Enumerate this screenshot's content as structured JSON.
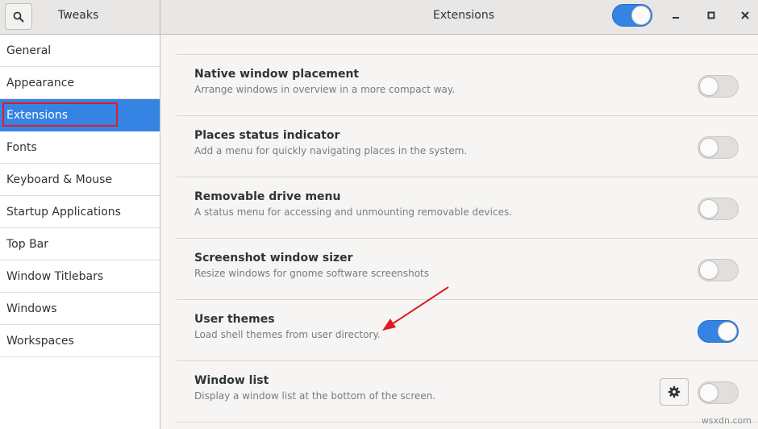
{
  "app": {
    "title": "Tweaks",
    "page_title": "Extensions",
    "extensions_global_enabled": true
  },
  "sidebar": {
    "items": [
      {
        "label": "General"
      },
      {
        "label": "Appearance"
      },
      {
        "label": "Extensions",
        "selected": true
      },
      {
        "label": "Fonts"
      },
      {
        "label": "Keyboard & Mouse"
      },
      {
        "label": "Startup Applications"
      },
      {
        "label": "Top Bar"
      },
      {
        "label": "Window Titlebars"
      },
      {
        "label": "Windows"
      },
      {
        "label": "Workspaces"
      }
    ]
  },
  "extensions": [
    {
      "name": "Native window placement",
      "description": "Arrange windows in overview in a more compact way.",
      "enabled": false,
      "has_settings": false
    },
    {
      "name": "Places status indicator",
      "description": "Add a menu for quickly navigating places in the system.",
      "enabled": false,
      "has_settings": false
    },
    {
      "name": "Removable drive menu",
      "description": "A status menu for accessing and unmounting removable devices.",
      "enabled": false,
      "has_settings": false
    },
    {
      "name": "Screenshot window sizer",
      "description": "Resize windows for gnome software screenshots",
      "enabled": false,
      "has_settings": false
    },
    {
      "name": "User themes",
      "description": "Load shell themes from user directory.",
      "enabled": true,
      "has_settings": false
    },
    {
      "name": "Window list",
      "description": "Display a window list at the bottom of the screen.",
      "enabled": false,
      "has_settings": true
    }
  ],
  "icons": {
    "search": "search-icon",
    "minimize": "minimize-icon",
    "maximize": "maximize-icon",
    "close": "close-icon",
    "settings": "gear-icon"
  },
  "colors": {
    "accent": "#3584e4",
    "annotation": "#e01b24"
  },
  "watermark": "wsxdn.com"
}
